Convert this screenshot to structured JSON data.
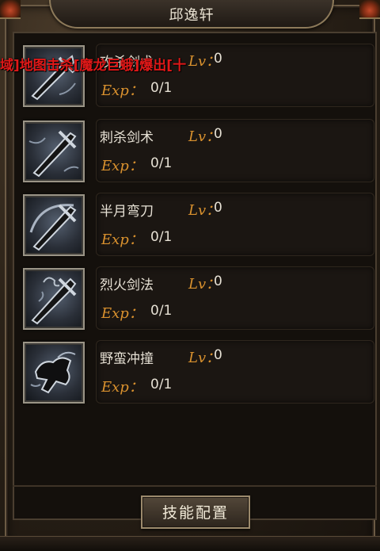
{
  "window": {
    "title": "邱逸轩"
  },
  "marquee_text": "域]地图击杀[魔龙巨蛾]爆出[十",
  "labels": {
    "lv": "Lv：",
    "exp": "Exp："
  },
  "skills": [
    {
      "name": "攻杀剑术",
      "level": "0",
      "exp": "0/1",
      "icon": "sword-icon"
    },
    {
      "name": "刺杀剑术",
      "level": "0",
      "exp": "0/1",
      "icon": "sword-icon"
    },
    {
      "name": "半月弯刀",
      "level": "0",
      "exp": "0/1",
      "icon": "crescent-sword-icon"
    },
    {
      "name": "烈火剑法",
      "level": "0",
      "exp": "0/1",
      "icon": "flame-sword-icon"
    },
    {
      "name": "野蛮冲撞",
      "level": "0",
      "exp": "0/1",
      "icon": "charge-icon"
    }
  ],
  "footer": {
    "config_button": "技能配置"
  }
}
